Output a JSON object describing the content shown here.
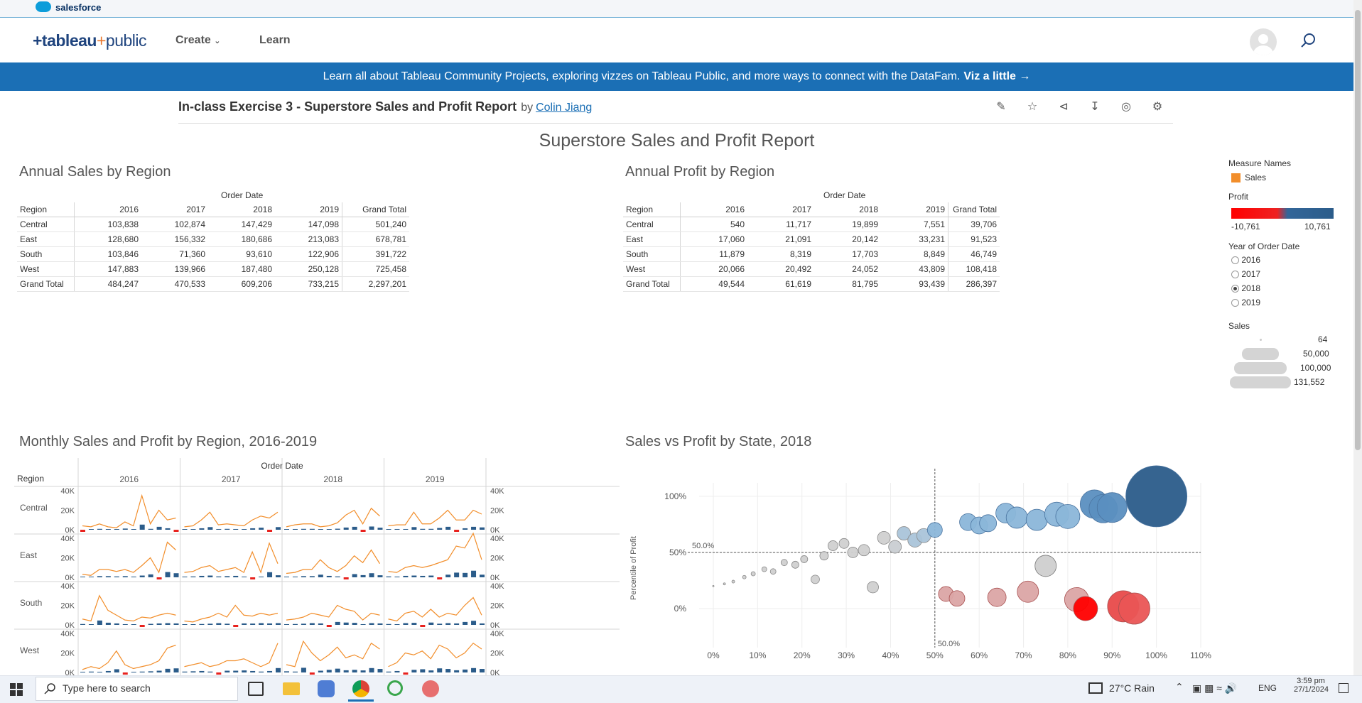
{
  "salesforce": {
    "brand": "salesforce"
  },
  "header": {
    "logo_main": "+tableau",
    "logo_plus": "+",
    "logo_public": "public",
    "nav": [
      {
        "label": "Create"
      },
      {
        "label": "Learn"
      }
    ]
  },
  "banner": {
    "text": "Learn all about Tableau Community Projects, exploring vizzes on Tableau Public, and more ways to connect with the DataFam.",
    "link": "Viz a little →"
  },
  "viz": {
    "title": "In-class Exercise 3 - Superstore Sales and Profit Report",
    "by": "by",
    "author": "Colin Jiang",
    "toolbar": [
      "edit-icon",
      "star-icon",
      "share-icon",
      "download-icon",
      "badge-icon",
      "settings-icon"
    ]
  },
  "dashboard": {
    "title": "Superstore Sales and Profit Report",
    "sales_table": {
      "title": "Annual Sales by Region",
      "group_header": "Order Date",
      "columns": [
        "Region",
        "2016",
        "2017",
        "2018",
        "2019",
        "Grand Total"
      ],
      "rows": [
        [
          "Central",
          "103,838",
          "102,874",
          "147,429",
          "147,098",
          "501,240"
        ],
        [
          "East",
          "128,680",
          "156,332",
          "180,686",
          "213,083",
          "678,781"
        ],
        [
          "South",
          "103,846",
          "71,360",
          "93,610",
          "122,906",
          "391,722"
        ],
        [
          "West",
          "147,883",
          "139,966",
          "187,480",
          "250,128",
          "725,458"
        ],
        [
          "Grand Total",
          "484,247",
          "470,533",
          "609,206",
          "733,215",
          "2,297,201"
        ]
      ]
    },
    "profit_table": {
      "title": "Annual Profit by Region",
      "group_header": "Order Date",
      "columns": [
        "Region",
        "2016",
        "2017",
        "2018",
        "2019",
        "Grand Total"
      ],
      "rows": [
        [
          "Central",
          "540",
          "11,717",
          "19,899",
          "7,551",
          "39,706"
        ],
        [
          "East",
          "17,060",
          "21,091",
          "20,142",
          "33,231",
          "91,523"
        ],
        [
          "South",
          "11,879",
          "8,319",
          "17,703",
          "8,849",
          "46,749"
        ],
        [
          "West",
          "20,066",
          "20,492",
          "24,052",
          "43,809",
          "108,418"
        ],
        [
          "Grand Total",
          "49,544",
          "61,619",
          "81,795",
          "93,439",
          "286,397"
        ]
      ]
    },
    "monthly": {
      "title": "Monthly Sales and Profit by Region, 2016-2019",
      "group_header": "Order Date",
      "region_header": "Region",
      "years": [
        "2016",
        "2017",
        "2018",
        "2019"
      ],
      "regions": [
        "Central",
        "East",
        "South",
        "West"
      ],
      "yticks": [
        "40K",
        "20K",
        "0K"
      ]
    },
    "scatter": {
      "title": "Sales vs Profit by State, 2018",
      "ylabel": "Percentile of Profit",
      "yticks": [
        "100%",
        "50%",
        "0%"
      ],
      "xticks": [
        "0%",
        "10%",
        "20%",
        "30%",
        "40%",
        "50%",
        "60%",
        "70%",
        "80%",
        "90%",
        "100%",
        "110%"
      ],
      "ref_x_label": "50.0%",
      "ref_y_label": "50.0%"
    },
    "legend": {
      "measure_names_title": "Measure Names",
      "measure_item": "Sales",
      "profit_title": "Profit",
      "profit_min": "-10,761",
      "profit_max": "10,761",
      "year_title": "Year of Order Date",
      "years": [
        "2016",
        "2017",
        "2018",
        "2019"
      ],
      "selected_year": "2018",
      "sales_title": "Sales",
      "sales_sizes": [
        "64",
        "50,000",
        "100,000",
        "131,552"
      ]
    }
  },
  "taskbar": {
    "search_placeholder": "Type here to search",
    "weather": "27°C  Rain",
    "lang": "ENG",
    "time": "3:59 pm",
    "date": "27/1/2024"
  },
  "colors": {
    "accent": "#1b6fb5",
    "sales": "#f28e2b",
    "profit_pos": "#2b5c8a",
    "profit_neg": "#e8221e"
  },
  "chart_data": [
    {
      "type": "scatter",
      "title": "Sales vs Profit by State, 2018",
      "xlabel": "",
      "ylabel": "Percentile of Profit",
      "xlim": [
        0,
        110
      ],
      "ylim": [
        0,
        100
      ],
      "points": [
        {
          "x": 0,
          "y": 20,
          "s": 1
        },
        {
          "x": 2.5,
          "y": 22,
          "s": 1.5
        },
        {
          "x": 4.5,
          "y": 24,
          "s": 2
        },
        {
          "x": 7,
          "y": 28,
          "s": 2.5
        },
        {
          "x": 9,
          "y": 31,
          "s": 3
        },
        {
          "x": 11.5,
          "y": 35,
          "s": 3.5
        },
        {
          "x": 13.5,
          "y": 33,
          "s": 4
        },
        {
          "x": 16,
          "y": 41,
          "s": 4.5
        },
        {
          "x": 18.5,
          "y": 39,
          "s": 5
        },
        {
          "x": 20.5,
          "y": 44,
          "s": 5
        },
        {
          "x": 23,
          "y": 26,
          "s": 6
        },
        {
          "x": 25,
          "y": 47,
          "s": 6
        },
        {
          "x": 27,
          "y": 56,
          "s": 7
        },
        {
          "x": 29.5,
          "y": 58,
          "s": 7
        },
        {
          "x": 31.5,
          "y": 50,
          "s": 7.5
        },
        {
          "x": 34,
          "y": 52,
          "s": 8
        },
        {
          "x": 36,
          "y": 19,
          "s": 8
        },
        {
          "x": 38.5,
          "y": 63,
          "s": 9
        },
        {
          "x": 41,
          "y": 55,
          "s": 9
        },
        {
          "x": 43,
          "y": 67,
          "s": 9.5
        },
        {
          "x": 45.5,
          "y": 61,
          "s": 10
        },
        {
          "x": 47.5,
          "y": 65,
          "s": 10
        },
        {
          "x": 50,
          "y": 70,
          "s": 10.5
        },
        {
          "x": 52.5,
          "y": 13,
          "s": 10.5
        },
        {
          "x": 55,
          "y": 9,
          "s": 11
        },
        {
          "x": 57.5,
          "y": 77,
          "s": 12
        },
        {
          "x": 60,
          "y": 74,
          "s": 12
        },
        {
          "x": 62,
          "y": 76,
          "s": 12
        },
        {
          "x": 64,
          "y": 10,
          "s": 13
        },
        {
          "x": 66,
          "y": 85,
          "s": 14
        },
        {
          "x": 68.5,
          "y": 81,
          "s": 15
        },
        {
          "x": 71,
          "y": 15,
          "s": 15
        },
        {
          "x": 73,
          "y": 79,
          "s": 15
        },
        {
          "x": 75,
          "y": 38,
          "s": 15
        },
        {
          "x": 77.5,
          "y": 84,
          "s": 17
        },
        {
          "x": 80,
          "y": 82,
          "s": 17
        },
        {
          "x": 82,
          "y": 8,
          "s": 17
        },
        {
          "x": 84,
          "y": 0,
          "s": 17
        },
        {
          "x": 86,
          "y": 93,
          "s": 20
        },
        {
          "x": 88,
          "y": 89,
          "s": 20
        },
        {
          "x": 90,
          "y": 90,
          "s": 21
        },
        {
          "x": 92.5,
          "y": 2,
          "s": 22
        },
        {
          "x": 95,
          "y": 0,
          "s": 22
        },
        {
          "x": 100,
          "y": 100,
          "s": 43
        }
      ],
      "ref_lines": {
        "x": 50,
        "y": 50
      }
    },
    {
      "type": "line",
      "title": "Monthly Sales and Profit by Region, 2016-2019",
      "note": "Sales line (orange) with profit bars (blue positive / red negative) per month for each region panel",
      "ylim": [
        0,
        40000
      ],
      "regions": [
        "Central",
        "East",
        "South",
        "West"
      ]
    }
  ]
}
